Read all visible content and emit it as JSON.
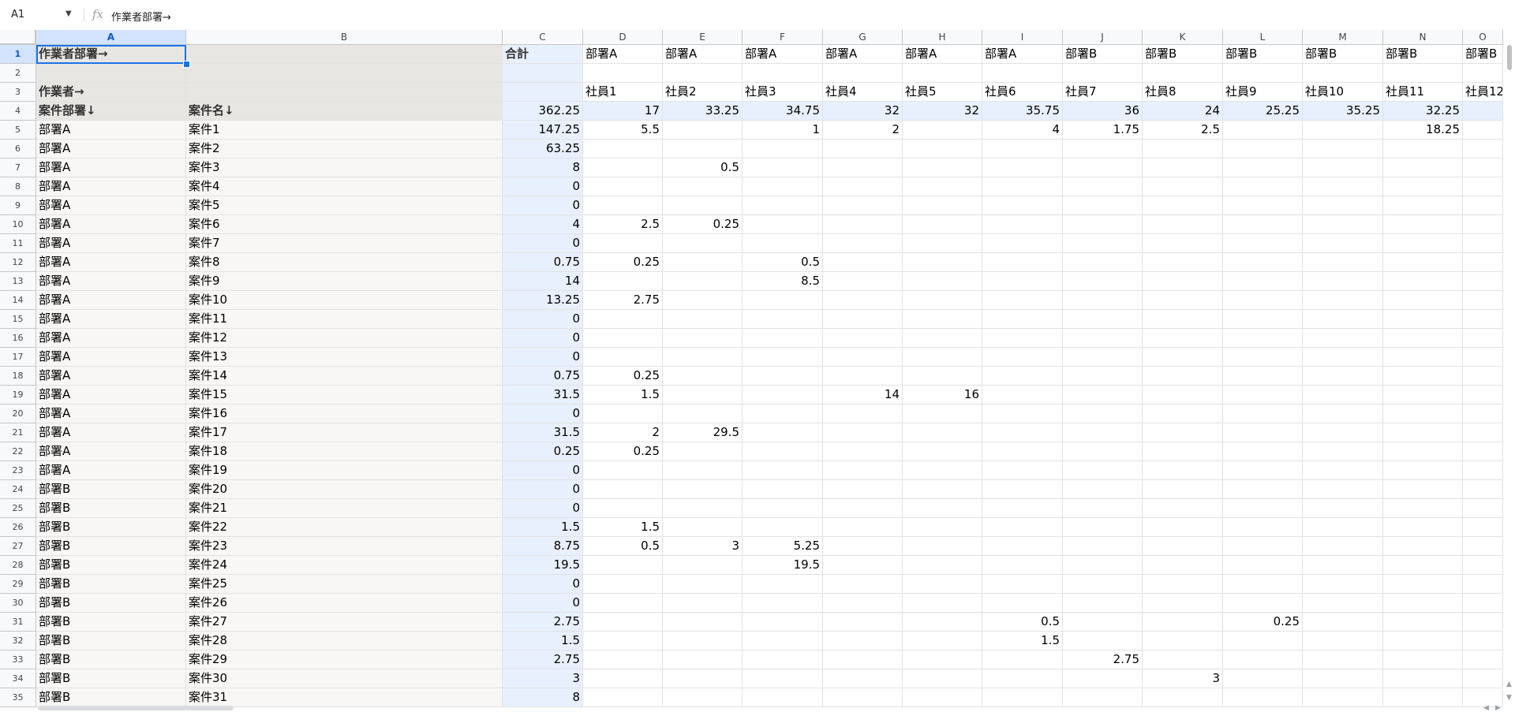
{
  "formula_bar": {
    "name_box": "A1",
    "fx_icon": "function-icon",
    "formula_value": "作業者部署→"
  },
  "columns": [
    "A",
    "B",
    "C",
    "D",
    "E",
    "F",
    "G",
    "H",
    "I",
    "J",
    "K",
    "L",
    "M",
    "N",
    "O"
  ],
  "row_numbers": [
    "1",
    "2",
    "3",
    "4",
    "5",
    "6",
    "7",
    "8",
    "9",
    "10",
    "11",
    "12",
    "13",
    "14",
    "15",
    "16",
    "17",
    "18",
    "19",
    "20",
    "21",
    "22",
    "23",
    "24",
    "25",
    "26",
    "27",
    "28",
    "29",
    "30",
    "31",
    "32",
    "33",
    "34",
    "35"
  ],
  "rows": [
    [
      "作業者部署→",
      "",
      "合計",
      "部署A",
      "部署A",
      "部署A",
      "部署A",
      "部署A",
      "部署A",
      "部署B",
      "部署B",
      "部署B",
      "部署B",
      "部署B",
      "部署B"
    ],
    [
      "",
      "",
      "",
      "",
      "",
      "",
      "",
      "",
      "",
      "",
      "",
      "",
      "",
      "",
      ""
    ],
    [
      "作業者→",
      "",
      "",
      "社員1",
      "社員2",
      "社員3",
      "社員4",
      "社員5",
      "社員6",
      "社員7",
      "社員8",
      "社員9",
      "社員10",
      "社員11",
      "社員12"
    ],
    [
      "案件部署↓",
      "案件名↓",
      "362.25",
      "17",
      "33.25",
      "34.75",
      "32",
      "32",
      "35.75",
      "36",
      "24",
      "25.25",
      "35.25",
      "32.25",
      ""
    ],
    [
      "部署A",
      "案件1",
      "147.25",
      "5.5",
      "",
      "1",
      "2",
      "",
      "4",
      "1.75",
      "2.5",
      "",
      "",
      "18.25",
      ""
    ],
    [
      "部署A",
      "案件2",
      "63.25",
      "",
      "",
      "",
      "",
      "",
      "",
      "",
      "",
      "",
      "",
      "",
      ""
    ],
    [
      "部署A",
      "案件3",
      "8",
      "",
      "0.5",
      "",
      "",
      "",
      "",
      "",
      "",
      "",
      "",
      "",
      ""
    ],
    [
      "部署A",
      "案件4",
      "0",
      "",
      "",
      "",
      "",
      "",
      "",
      "",
      "",
      "",
      "",
      "",
      ""
    ],
    [
      "部署A",
      "案件5",
      "0",
      "",
      "",
      "",
      "",
      "",
      "",
      "",
      "",
      "",
      "",
      "",
      ""
    ],
    [
      "部署A",
      "案件6",
      "4",
      "2.5",
      "0.25",
      "",
      "",
      "",
      "",
      "",
      "",
      "",
      "",
      "",
      ""
    ],
    [
      "部署A",
      "案件7",
      "0",
      "",
      "",
      "",
      "",
      "",
      "",
      "",
      "",
      "",
      "",
      "",
      ""
    ],
    [
      "部署A",
      "案件8",
      "0.75",
      "0.25",
      "",
      "0.5",
      "",
      "",
      "",
      "",
      "",
      "",
      "",
      "",
      ""
    ],
    [
      "部署A",
      "案件9",
      "14",
      "",
      "",
      "8.5",
      "",
      "",
      "",
      "",
      "",
      "",
      "",
      "",
      ""
    ],
    [
      "部署A",
      "案件10",
      "13.25",
      "2.75",
      "",
      "",
      "",
      "",
      "",
      "",
      "",
      "",
      "",
      "",
      ""
    ],
    [
      "部署A",
      "案件11",
      "0",
      "",
      "",
      "",
      "",
      "",
      "",
      "",
      "",
      "",
      "",
      "",
      ""
    ],
    [
      "部署A",
      "案件12",
      "0",
      "",
      "",
      "",
      "",
      "",
      "",
      "",
      "",
      "",
      "",
      "",
      ""
    ],
    [
      "部署A",
      "案件13",
      "0",
      "",
      "",
      "",
      "",
      "",
      "",
      "",
      "",
      "",
      "",
      "",
      ""
    ],
    [
      "部署A",
      "案件14",
      "0.75",
      "0.25",
      "",
      "",
      "",
      "",
      "",
      "",
      "",
      "",
      "",
      "",
      ""
    ],
    [
      "部署A",
      "案件15",
      "31.5",
      "1.5",
      "",
      "",
      "14",
      "16",
      "",
      "",
      "",
      "",
      "",
      "",
      ""
    ],
    [
      "部署A",
      "案件16",
      "0",
      "",
      "",
      "",
      "",
      "",
      "",
      "",
      "",
      "",
      "",
      "",
      ""
    ],
    [
      "部署A",
      "案件17",
      "31.5",
      "2",
      "29.5",
      "",
      "",
      "",
      "",
      "",
      "",
      "",
      "",
      "",
      ""
    ],
    [
      "部署A",
      "案件18",
      "0.25",
      "0.25",
      "",
      "",
      "",
      "",
      "",
      "",
      "",
      "",
      "",
      "",
      ""
    ],
    [
      "部署A",
      "案件19",
      "0",
      "",
      "",
      "",
      "",
      "",
      "",
      "",
      "",
      "",
      "",
      "",
      ""
    ],
    [
      "部署B",
      "案件20",
      "0",
      "",
      "",
      "",
      "",
      "",
      "",
      "",
      "",
      "",
      "",
      "",
      ""
    ],
    [
      "部署B",
      "案件21",
      "0",
      "",
      "",
      "",
      "",
      "",
      "",
      "",
      "",
      "",
      "",
      "",
      ""
    ],
    [
      "部署B",
      "案件22",
      "1.5",
      "1.5",
      "",
      "",
      "",
      "",
      "",
      "",
      "",
      "",
      "",
      "",
      ""
    ],
    [
      "部署B",
      "案件23",
      "8.75",
      "0.5",
      "3",
      "5.25",
      "",
      "",
      "",
      "",
      "",
      "",
      "",
      "",
      ""
    ],
    [
      "部署B",
      "案件24",
      "19.5",
      "",
      "",
      "19.5",
      "",
      "",
      "",
      "",
      "",
      "",
      "",
      "",
      ""
    ],
    [
      "部署B",
      "案件25",
      "0",
      "",
      "",
      "",
      "",
      "",
      "",
      "",
      "",
      "",
      "",
      "",
      ""
    ],
    [
      "部署B",
      "案件26",
      "0",
      "",
      "",
      "",
      "",
      "",
      "",
      "",
      "",
      "",
      "",
      "",
      ""
    ],
    [
      "部署B",
      "案件27",
      "2.75",
      "",
      "",
      "",
      "",
      "",
      "0.5",
      "",
      "",
      "0.25",
      "",
      "",
      ""
    ],
    [
      "部署B",
      "案件28",
      "1.5",
      "",
      "",
      "",
      "",
      "",
      "1.5",
      "",
      "",
      "",
      "",
      "",
      ""
    ],
    [
      "部署B",
      "案件29",
      "2.75",
      "",
      "",
      "",
      "",
      "",
      "",
      "2.75",
      "",
      "",
      "",
      "",
      ""
    ],
    [
      "部署B",
      "案件30",
      "3",
      "",
      "",
      "",
      "",
      "",
      "",
      "",
      "3",
      "",
      "",
      "",
      ""
    ],
    [
      "部署B",
      "案件31",
      "8",
      "",
      "",
      "",
      "",
      "",
      "",
      "",
      "",
      "",
      "",
      "",
      ""
    ]
  ],
  "colors": {
    "selection": "#1a73e8",
    "total_column_bg": "#e8f0fe",
    "label_bg": "#e8e6e3",
    "column_a_bg": "#f8f7f5"
  }
}
